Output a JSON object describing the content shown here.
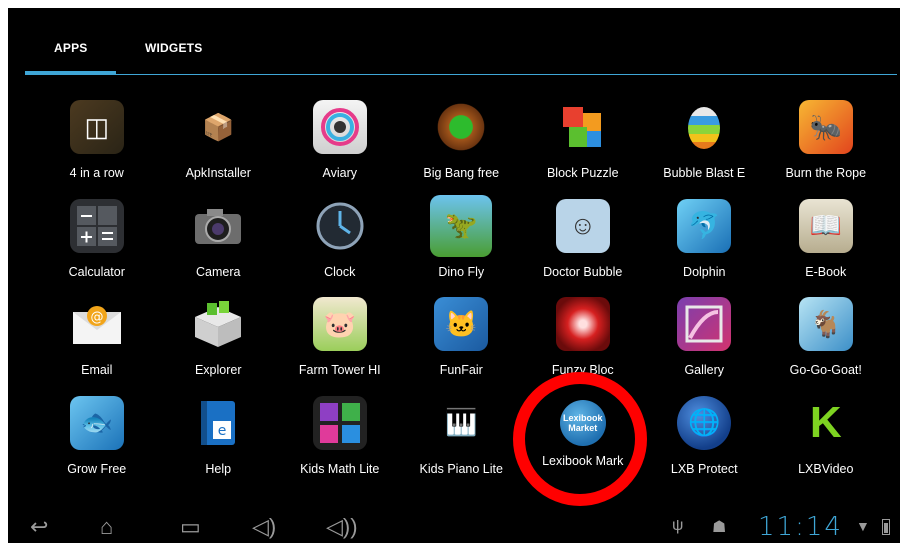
{
  "tabs": [
    {
      "label": "APPS",
      "selected": true
    },
    {
      "label": "WIDGETS",
      "selected": false
    }
  ],
  "apps": [
    {
      "label": "4 in a row",
      "icon": "four-in-a-row-icon",
      "glyph": "◫"
    },
    {
      "label": "ApkInstaller",
      "icon": "package-icon",
      "glyph": "📦"
    },
    {
      "label": "Aviary",
      "icon": "camera-lens-icon",
      "glyph": "◎"
    },
    {
      "label": "Big Bang free",
      "icon": "bomb-icon",
      "glyph": "✹"
    },
    {
      "label": "Block Puzzle",
      "icon": "blocks-icon",
      "glyph": "▞"
    },
    {
      "label": "Bubble Blast E",
      "icon": "egg-icon",
      "glyph": "🥚"
    },
    {
      "label": "Burn the Rope",
      "icon": "ant-icon",
      "glyph": "🐜"
    },
    {
      "label": "Calculator",
      "icon": "calculator-icon",
      "glyph": "±"
    },
    {
      "label": "Camera",
      "icon": "camera-icon",
      "glyph": "📷"
    },
    {
      "label": "Clock",
      "icon": "clock-icon",
      "glyph": "🕑"
    },
    {
      "label": "Dino Fly",
      "icon": "dinosaur-icon",
      "glyph": "🦖"
    },
    {
      "label": "Doctor Bubble",
      "icon": "doctor-icon",
      "glyph": "☺"
    },
    {
      "label": "Dolphin",
      "icon": "dolphin-icon",
      "glyph": "🐬"
    },
    {
      "label": "E-Book",
      "icon": "book-icon",
      "glyph": "📖"
    },
    {
      "label": "Email",
      "icon": "envelope-icon",
      "glyph": "✉"
    },
    {
      "label": "Explorer",
      "icon": "folder-icon",
      "glyph": "📂"
    },
    {
      "label": "Farm Tower HI",
      "icon": "pig-icon",
      "glyph": "🐷"
    },
    {
      "label": "FunFair",
      "icon": "cat-icon",
      "glyph": "🐱"
    },
    {
      "label": "Funzy Bloc",
      "icon": "spiral-icon",
      "glyph": "◉"
    },
    {
      "label": "Gallery",
      "icon": "gallery-icon",
      "glyph": "🖼"
    },
    {
      "label": "Go-Go-Goat!",
      "icon": "goat-icon",
      "glyph": "🐐"
    },
    {
      "label": "Grow Free",
      "icon": "fish-icon",
      "glyph": "🐟"
    },
    {
      "label": "Help",
      "icon": "help-book-icon",
      "glyph": "e"
    },
    {
      "label": "Kids Math Lite",
      "icon": "numbers-icon",
      "glyph": "⊞"
    },
    {
      "label": "Kids Piano Lite",
      "icon": "piano-icon",
      "glyph": "🎹"
    },
    {
      "label": "Lexibook Mark",
      "icon": "lexibook-market-icon",
      "glyph": "",
      "sublabel": "Lexibook Market"
    },
    {
      "label": "LXB Protect",
      "icon": "globe-shield-icon",
      "glyph": "🌐"
    },
    {
      "label": "LXBVideo",
      "icon": "video-k-icon",
      "glyph": "K"
    }
  ],
  "statusbar": {
    "time": "11:14"
  },
  "navbar": {
    "back_glyph": "↩",
    "home_glyph": "⌂",
    "recent_glyph": "▭",
    "voldown_glyph": "◁)",
    "volup_glyph": "◁))",
    "usb_glyph": "ψ",
    "android_glyph": "☗",
    "wifi_glyph": "▼"
  },
  "colors": {
    "accent": "#3fa6d6",
    "highlight": "#ff0000",
    "background": "#000000"
  }
}
